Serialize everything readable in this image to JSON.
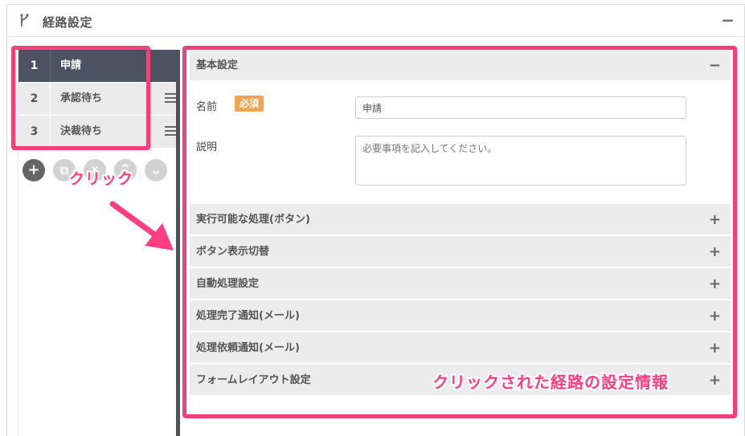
{
  "panel": {
    "title": "経路設定",
    "collapse_symbol": "−"
  },
  "steps": [
    {
      "num": "1",
      "label": "申請",
      "active": true
    },
    {
      "num": "2",
      "label": "承認待ち",
      "active": false
    },
    {
      "num": "3",
      "label": "決裁待ち",
      "active": false
    }
  ],
  "tools": [
    {
      "name": "add-step-button",
      "symbol": "+"
    },
    {
      "name": "copy-step-button",
      "symbol": "⧉"
    },
    {
      "name": "delete-step-button",
      "symbol": "✕"
    },
    {
      "name": "move-up-button",
      "symbol": "⌃"
    },
    {
      "name": "move-down-button",
      "symbol": "⌄"
    }
  ],
  "basic": {
    "title": "基本設定",
    "toggle": "−",
    "name_label": "名前",
    "required_badge": "必須",
    "name_value": "申請",
    "desc_label": "説明",
    "desc_placeholder": "必要事項を記入してください。"
  },
  "sections": [
    {
      "title": "実行可能な処理(ボタン)",
      "toggle": "+"
    },
    {
      "title": "ボタン表示切替",
      "toggle": "+"
    },
    {
      "title": "自動処理設定",
      "toggle": "+"
    },
    {
      "title": "処理完了通知(メール)",
      "toggle": "+"
    },
    {
      "title": "処理依頼通知(メール)",
      "toggle": "+"
    },
    {
      "title": "フォームレイアウト設定",
      "toggle": "+"
    }
  ],
  "annotations": {
    "click": "クリック",
    "info": "クリックされた経路の設定情報"
  },
  "colors": {
    "accent": "#f2407a",
    "active_step": "#4b5262",
    "badge": "#eea653"
  }
}
